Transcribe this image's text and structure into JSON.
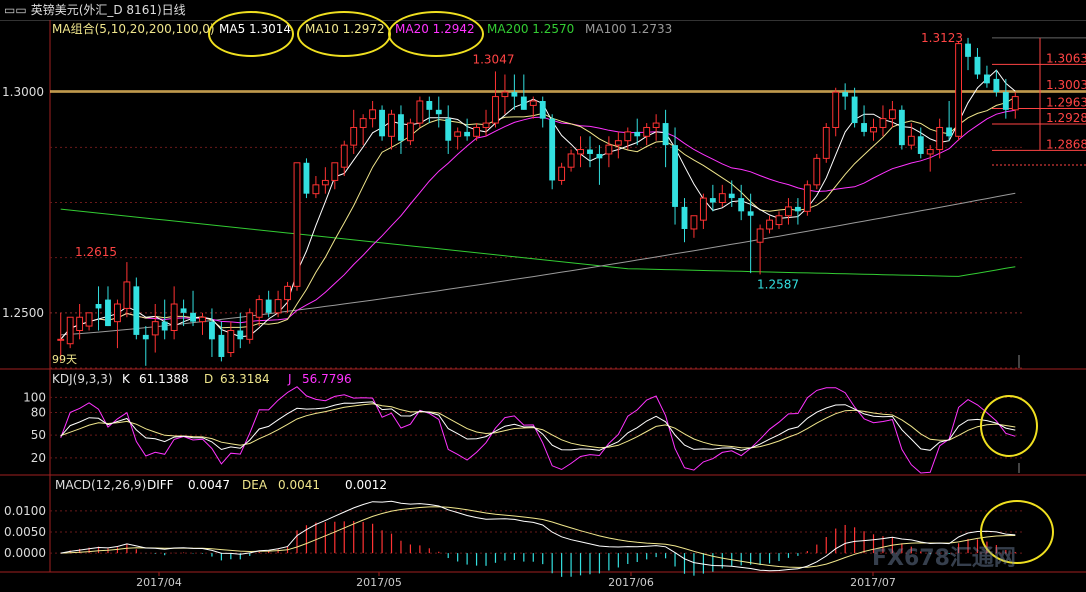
{
  "window": {
    "title": "英镑美元(外汇_D 8161)日线",
    "icon": "window-icon"
  },
  "main_panel": {
    "indicator_label": "MA组合(5,10,20,200,100,0)",
    "ma_values": [
      {
        "label": "MA5 1.3014",
        "color": "#ffffff"
      },
      {
        "label": "MA10 1.2972",
        "color": "#f0e68c"
      },
      {
        "label": "MA20 1.2942",
        "color": "#ff33ff"
      },
      {
        "label": "MA200 1.2570",
        "color": "#33cc33"
      },
      {
        "label": "MA100 1.2733",
        "color": "#9a9a9a"
      }
    ],
    "price_labels": [
      "1.3000",
      "1.2500"
    ],
    "annotations": {
      "high_may": "1.3047",
      "high_apr": "1.2615",
      "low_jun": "1.2587",
      "high_jul": "1.3123",
      "corner": "99天"
    },
    "level_lines": [
      "1.3063",
      "1.3003",
      "1.2963",
      "1.2928",
      "1.2868"
    ]
  },
  "kdj_panel": {
    "label": "KDJ(9,3,3)",
    "k_label": "K",
    "k_value": "61.1388",
    "d_label": "D",
    "d_value": "63.3184",
    "j_label": "J",
    "j_value": "56.7796",
    "axis_ticks": [
      "100",
      "80",
      "50",
      "20"
    ]
  },
  "macd_panel": {
    "label": "MACD(12,26,9)",
    "diff_label": "DIFF",
    "diff_value": "0.0047",
    "dea_label": "DEA",
    "dea_value": "0.0041",
    "macd_value": "0.0012",
    "axis_ticks": [
      "0.0100",
      "0.0050",
      "0.0000"
    ]
  },
  "x_axis": {
    "labels": [
      "2017/04",
      "2017/05",
      "2017/06",
      "2017/07"
    ]
  },
  "watermark": "FX678汇通网",
  "colors": {
    "up": "#ff3333",
    "down": "#33e0e0",
    "highlight_ring": "#f0e020"
  },
  "chart_data": {
    "type": "candlestick",
    "y_range": [
      1.2375,
      1.3125
    ],
    "candles": [
      [
        1.244,
        1.25,
        1.244,
        1.239
      ],
      [
        1.243,
        1.249,
        1.249,
        1.242
      ],
      [
        1.246,
        1.252,
        1.249,
        1.244
      ],
      [
        1.247,
        1.25,
        1.25,
        1.246
      ],
      [
        1.252,
        1.256,
        1.251,
        1.246
      ],
      [
        1.253,
        1.256,
        1.247,
        1.247
      ],
      [
        1.248,
        1.253,
        1.252,
        1.242
      ],
      [
        1.251,
        1.2615,
        1.257,
        1.249
      ],
      [
        1.256,
        1.258,
        1.245,
        1.244
      ],
      [
        1.245,
        1.247,
        1.244,
        1.238
      ],
      [
        1.245,
        1.252,
        1.248,
        1.241
      ],
      [
        1.248,
        1.253,
        1.246,
        1.244
      ],
      [
        1.246,
        1.256,
        1.252,
        1.244
      ],
      [
        1.251,
        1.253,
        1.25,
        1.247
      ],
      [
        1.25,
        1.255,
        1.248,
        1.247
      ],
      [
        1.248,
        1.25,
        1.249,
        1.245
      ],
      [
        1.248,
        1.251,
        1.244,
        1.24
      ],
      [
        1.245,
        1.248,
        1.24,
        1.239
      ],
      [
        1.241,
        1.248,
        1.246,
        1.24
      ],
      [
        1.246,
        1.25,
        1.244,
        1.242
      ],
      [
        1.244,
        1.251,
        1.25,
        1.243
      ],
      [
        1.249,
        1.254,
        1.253,
        1.247
      ],
      [
        1.253,
        1.255,
        1.25,
        1.249
      ],
      [
        1.25,
        1.255,
        1.253,
        1.249
      ],
      [
        1.253,
        1.257,
        1.256,
        1.25
      ],
      [
        1.256,
        1.284,
        1.284,
        1.255
      ],
      [
        1.284,
        1.285,
        1.277,
        1.276
      ],
      [
        1.277,
        1.281,
        1.279,
        1.276
      ],
      [
        1.279,
        1.283,
        1.28,
        1.277
      ],
      [
        1.28,
        1.284,
        1.284,
        1.278
      ],
      [
        1.283,
        1.289,
        1.288,
        1.281
      ],
      [
        1.288,
        1.296,
        1.292,
        1.286
      ],
      [
        1.292,
        1.295,
        1.294,
        1.288
      ],
      [
        1.294,
        1.298,
        1.296,
        1.292
      ],
      [
        1.296,
        1.297,
        1.29,
        1.289
      ],
      [
        1.29,
        1.296,
        1.295,
        1.287
      ],
      [
        1.295,
        1.297,
        1.289,
        1.286
      ],
      [
        1.289,
        1.294,
        1.293,
        1.288
      ],
      [
        1.293,
        1.299,
        1.298,
        1.292
      ],
      [
        1.298,
        1.299,
        1.296,
        1.293
      ],
      [
        1.296,
        1.299,
        1.295,
        1.292
      ],
      [
        1.294,
        1.297,
        1.289,
        1.286
      ],
      [
        1.29,
        1.292,
        1.291,
        1.287
      ],
      [
        1.291,
        1.294,
        1.29,
        1.289
      ],
      [
        1.29,
        1.293,
        1.292,
        1.289
      ],
      [
        1.292,
        1.296,
        1.293,
        1.29
      ],
      [
        1.293,
        1.3047,
        1.299,
        1.292
      ],
      [
        1.299,
        1.304,
        1.3,
        1.295
      ],
      [
        1.3,
        1.304,
        1.299,
        1.296
      ],
      [
        1.299,
        1.304,
        1.296,
        1.296
      ],
      [
        1.297,
        1.299,
        1.298,
        1.294
      ],
      [
        1.298,
        1.299,
        1.294,
        1.292
      ],
      [
        1.294,
        1.295,
        1.28,
        1.278
      ],
      [
        1.28,
        1.284,
        1.283,
        1.279
      ],
      [
        1.283,
        1.287,
        1.286,
        1.282
      ],
      [
        1.286,
        1.29,
        1.287,
        1.283
      ],
      [
        1.287,
        1.29,
        1.286,
        1.283
      ],
      [
        1.286,
        1.288,
        1.285,
        1.279
      ],
      [
        1.286,
        1.29,
        1.288,
        1.283
      ],
      [
        1.288,
        1.291,
        1.289,
        1.285
      ],
      [
        1.289,
        1.292,
        1.291,
        1.287
      ],
      [
        1.291,
        1.294,
        1.29,
        1.288
      ],
      [
        1.29,
        1.293,
        1.292,
        1.288
      ],
      [
        1.292,
        1.295,
        1.293,
        1.289
      ],
      [
        1.293,
        1.296,
        1.288,
        1.283
      ],
      [
        1.288,
        1.292,
        1.274,
        1.27
      ],
      [
        1.274,
        1.276,
        1.269,
        1.266
      ],
      [
        1.269,
        1.272,
        1.272,
        1.267
      ],
      [
        1.271,
        1.277,
        1.276,
        1.269
      ],
      [
        1.276,
        1.279,
        1.275,
        1.273
      ],
      [
        1.275,
        1.279,
        1.277,
        1.274
      ],
      [
        1.277,
        1.28,
        1.276,
        1.274
      ],
      [
        1.276,
        1.279,
        1.273,
        1.271
      ],
      [
        1.273,
        1.277,
        1.272,
        1.259
      ],
      [
        1.266,
        1.27,
        1.269,
        1.2587
      ],
      [
        1.269,
        1.272,
        1.271,
        1.268
      ],
      [
        1.27,
        1.273,
        1.272,
        1.269
      ],
      [
        1.272,
        1.276,
        1.274,
        1.27
      ],
      [
        1.274,
        1.276,
        1.273,
        1.27
      ],
      [
        1.273,
        1.28,
        1.279,
        1.272
      ],
      [
        1.279,
        1.286,
        1.285,
        1.278
      ],
      [
        1.285,
        1.293,
        1.292,
        1.284
      ],
      [
        1.292,
        1.301,
        1.3,
        1.29
      ],
      [
        1.3,
        1.302,
        1.299,
        1.296
      ],
      [
        1.299,
        1.301,
        1.293,
        1.292
      ],
      [
        1.293,
        1.297,
        1.291,
        1.29
      ],
      [
        1.291,
        1.294,
        1.292,
        1.289
      ],
      [
        1.292,
        1.297,
        1.294,
        1.29
      ],
      [
        1.294,
        1.298,
        1.296,
        1.292
      ],
      [
        1.296,
        1.297,
        1.288,
        1.287
      ],
      [
        1.288,
        1.293,
        1.29,
        1.287
      ],
      [
        1.29,
        1.292,
        1.286,
        1.285
      ],
      [
        1.286,
        1.288,
        1.287,
        1.282
      ],
      [
        1.287,
        1.294,
        1.292,
        1.285
      ],
      [
        1.292,
        1.298,
        1.29,
        1.289
      ],
      [
        1.29,
        1.3115,
        1.311,
        1.289
      ],
      [
        1.311,
        1.3123,
        1.308,
        1.305
      ],
      [
        1.308,
        1.31,
        1.304,
        1.303
      ],
      [
        1.304,
        1.306,
        1.302,
        1.301
      ],
      [
        1.303,
        1.305,
        1.3,
        1.299
      ],
      [
        1.3,
        1.303,
        1.296,
        1.294
      ],
      [
        1.296,
        1.3,
        1.299,
        1.294
      ]
    ],
    "kdj_range": [
      0,
      115
    ],
    "macd_range": [
      -0.004,
      0.014
    ]
  }
}
